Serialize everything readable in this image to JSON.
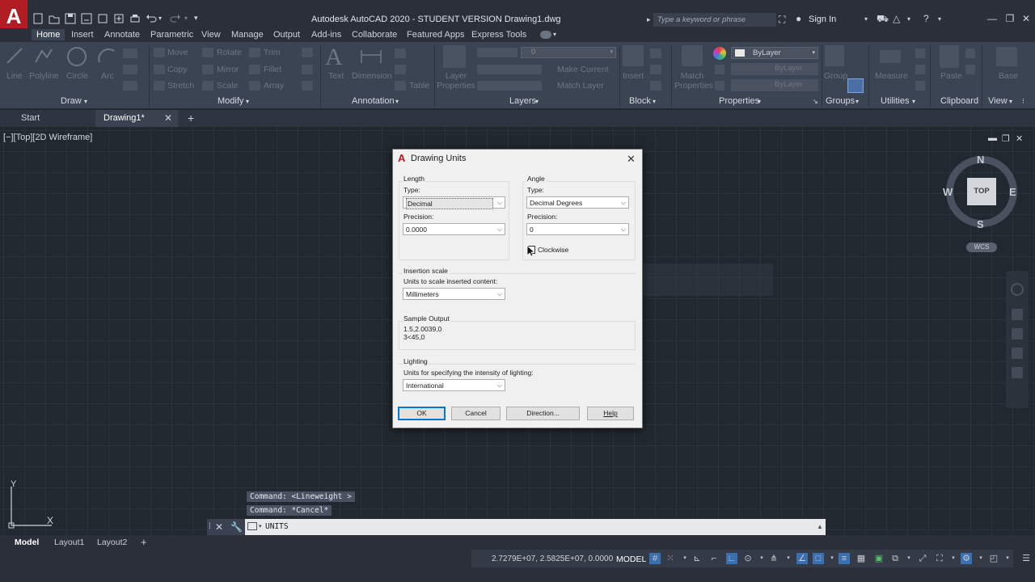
{
  "title_bar": {
    "app_logo": "A",
    "title": "Autodesk AutoCAD 2020 - STUDENT VERSION    Drawing1.dwg",
    "search_placeholder": "Type a keyword or phrase",
    "sign_in": "Sign In"
  },
  "ribbon_tabs": [
    "Home",
    "Insert",
    "Annotate",
    "Parametric",
    "View",
    "Manage",
    "Output",
    "Add-ins",
    "Collaborate",
    "Featured Apps",
    "Express Tools"
  ],
  "ribbon": {
    "draw": {
      "title": "Draw",
      "tools": [
        "Line",
        "Polyline",
        "Circle",
        "Arc"
      ]
    },
    "modify": {
      "title": "Modify",
      "tools": [
        "Move",
        "Rotate",
        "Trim",
        "Copy",
        "Mirror",
        "Fillet",
        "Stretch",
        "Scale",
        "Array"
      ]
    },
    "annotation": {
      "title": "Annotation",
      "tools": [
        "Text",
        "Dimension",
        "Table"
      ]
    },
    "layers": {
      "title": "Layers",
      "tools": [
        "Layer Properties",
        "Make Current",
        "Match Layer"
      ],
      "layer_value": "0"
    },
    "block": {
      "title": "Block",
      "tools": [
        "Insert"
      ]
    },
    "properties": {
      "title": "Properties",
      "tools": [
        "Match Properties"
      ],
      "bylayer": [
        "ByLayer",
        "ByLayer",
        "ByLayer"
      ]
    },
    "groups": {
      "title": "Groups",
      "tools": [
        "Group"
      ]
    },
    "utilities": {
      "title": "Utilities",
      "tools": [
        "Measure"
      ]
    },
    "clipboard": {
      "title": "Clipboard",
      "tools": [
        "Paste"
      ]
    },
    "view": {
      "title": "View",
      "tools": [
        "Base"
      ]
    }
  },
  "doc_tabs": {
    "start": "Start",
    "drawing": "Drawing1*",
    "new_tab": "+"
  },
  "viewport": {
    "label": "[−][Top][2D Wireframe]"
  },
  "viewcube": {
    "n": "N",
    "s": "S",
    "e": "E",
    "w": "W",
    "top": "TOP",
    "wcs": "WCS"
  },
  "dialog": {
    "title": "Drawing Units",
    "length": {
      "group": "Length",
      "type_label": "Type:",
      "type_value": "Decimal",
      "precision_label": "Precision:",
      "precision_value": "0.0000"
    },
    "angle": {
      "group": "Angle",
      "type_label": "Type:",
      "type_value": "Decimal Degrees",
      "precision_label": "Precision:",
      "precision_value": "0",
      "clockwise": "Clockwise"
    },
    "insertion": {
      "group": "Insertion scale",
      "label": "Units to scale inserted content:",
      "value": "Millimeters"
    },
    "sample": {
      "group": "Sample Output",
      "line1": "1.5,2.0039,0",
      "line2": "3<45,0"
    },
    "lighting": {
      "group": "Lighting",
      "label": "Units for specifying the intensity of lighting:",
      "value": "International"
    },
    "buttons": {
      "ok": "OK",
      "cancel": "Cancel",
      "direction": "Direction...",
      "help": "Help"
    }
  },
  "command": {
    "history1": "Command:  <Lineweight >",
    "history2": "Command: *Cancel*",
    "current": "UNITS"
  },
  "layout_tabs": [
    "Model",
    "Layout1",
    "Layout2"
  ],
  "status": {
    "coords": "2.7279E+07, 2.5825E+07, 0.0000",
    "mode": "MODEL"
  },
  "ucs": {
    "x": "X",
    "y": "Y"
  },
  "colors": {
    "accent": "#0078d7",
    "background": "#212830",
    "ribbon": "#3b4452",
    "logo_red": "#b01e23"
  }
}
